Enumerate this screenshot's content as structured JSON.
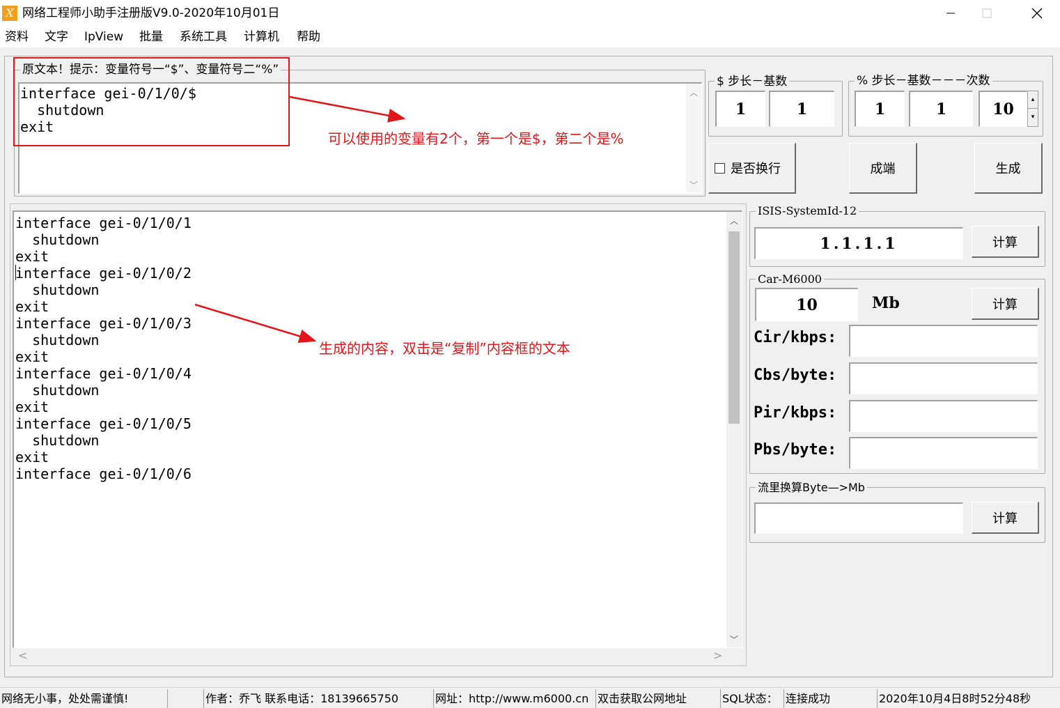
{
  "window": {
    "icon_letter": "X",
    "title": "网络工程师小助手注册版V9.0-2020年10月01日"
  },
  "menu": [
    "资料",
    "文字",
    "IpView",
    "批量",
    "系统工具",
    "计算机",
    "帮助"
  ],
  "template_box": {
    "legend": "原文本！提示：变量符号一“$”、变量符号二“%”",
    "lines": [
      "interface gei-0/1/0/$",
      "  shutdown",
      "exit"
    ]
  },
  "dollar_group": {
    "legend": "$ 步长－基数",
    "step": "1",
    "base": "1"
  },
  "percent_group": {
    "legend": "% 步长－基数－－－次数",
    "step": "1",
    "base": "1",
    "count": "10"
  },
  "wrap_checkbox": {
    "label": "是否换行",
    "checked": false
  },
  "buttons": {
    "pair": "成端",
    "generate": "生成",
    "calc": "计算"
  },
  "output_lines": [
    "interface gei-0/1/0/1",
    "  shutdown",
    "exit",
    "",
    "",
    "interface gei-0/1/0/2",
    "  shutdown",
    "exit",
    "",
    "",
    "interface gei-0/1/0/3",
    "  shutdown",
    "exit",
    "",
    "",
    "interface gei-0/1/0/4",
    "  shutdown",
    "exit",
    "",
    "",
    "interface gei-0/1/0/5",
    "  shutdown",
    "exit",
    "",
    "",
    "interface gei-0/1/0/6"
  ],
  "isis": {
    "legend": "ISIS-SystemId-12",
    "value": "1.1.1.1"
  },
  "car": {
    "legend": "Car-M6000",
    "value": "10",
    "unit": "Mb",
    "fields": [
      {
        "label": "Cir/kbps:",
        "value": ""
      },
      {
        "label": "Cbs/byte:",
        "value": ""
      },
      {
        "label": "Pir/kbps:",
        "value": ""
      },
      {
        "label": "Pbs/byte:",
        "value": ""
      }
    ]
  },
  "flow": {
    "legend": "流里换算Byte—>Mb",
    "value": ""
  },
  "annotations": {
    "top": "可以使用的变量有2个，第一个是$，第二个是%",
    "bottom": "生成的内容，双击是“复制”内容框的文本"
  },
  "status_bar": [
    "网络无小事，处处需谨慎!",
    "",
    "作者：乔飞  联系电话：18139665750",
    "网址：http://www.m6000.cn",
    "双击获取公网地址",
    "SQL状态：",
    "连接成功",
    "2020年10月4日8时52分48秒"
  ],
  "colors": {
    "annotation_red": "#e0161a",
    "app_icon_orange": "#f0a020"
  }
}
